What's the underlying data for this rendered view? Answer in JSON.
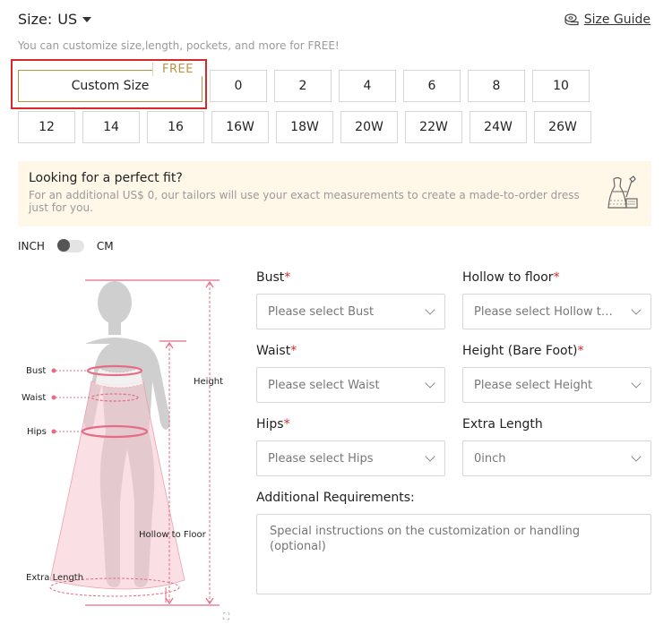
{
  "size": {
    "label": "Size:",
    "unit": "US",
    "guide_label": "Size Guide",
    "hint": "You can customize size,length, pockets, and more for FREE!",
    "custom_label": "Custom Size",
    "free_tag": "FREE",
    "row1": [
      "0",
      "2",
      "4",
      "6",
      "8",
      "10"
    ],
    "row2": [
      "12",
      "14",
      "16",
      "16W",
      "18W",
      "20W",
      "22W",
      "24W",
      "26W"
    ]
  },
  "perfect_fit": {
    "title": "Looking for a perfect fit?",
    "desc": "For an additional US$ 0, our tailors will use your exact measurements to create a made-to-order dress just for you."
  },
  "units": {
    "left": "INCH",
    "right": "CM",
    "selected": "INCH"
  },
  "figure_labels": {
    "bust": "Bust",
    "waist": "Waist",
    "hips": "Hips",
    "height": "Height",
    "hollow": "Hollow to Floor",
    "extra": "Extra Length"
  },
  "fields": {
    "bust": {
      "label": "Bust",
      "required": "*",
      "placeholder": "Please select Bust"
    },
    "hollow": {
      "label": "Hollow to floor",
      "required": "*",
      "placeholder": "Please select Hollow to..."
    },
    "waist": {
      "label": "Waist",
      "required": "*",
      "placeholder": "Please select Waist"
    },
    "height": {
      "label": "Height (Bare Foot)",
      "required": "*",
      "placeholder": "Please select Height"
    },
    "hips": {
      "label": "Hips",
      "required": "*",
      "placeholder": "Please select Hips"
    },
    "extra": {
      "label": "Extra Length",
      "value": "0inch"
    }
  },
  "additional": {
    "label": "Additional Requirements:",
    "placeholder": "Special instructions on the customization or handling (optional)"
  },
  "colors": {
    "accent_gold": "#b89445",
    "highlight_red": "#d52a2a",
    "banner_bg": "#fff7e8",
    "measure_pink": "#e86b86"
  }
}
